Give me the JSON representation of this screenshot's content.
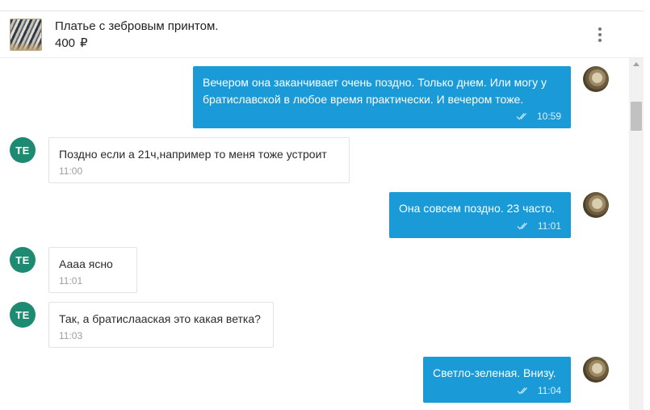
{
  "header": {
    "product_title": "Платье с зебровым принтом.",
    "price": "400",
    "currency": "₽",
    "thumbnail_icon": "dress-thumbnail",
    "menu_icon": "more-vertical-icon"
  },
  "contact": {
    "initials": "TE"
  },
  "messages": [
    {
      "direction": "out",
      "text": "Вечером она заканчивает очень поздно. Только днем. Или могу у братиславской в любое время практически. И вечером тоже.",
      "time": "10:59"
    },
    {
      "direction": "in",
      "text": "Поздно если а 21ч,например то меня тоже устроит",
      "time": "11:00"
    },
    {
      "direction": "out",
      "text": "Она совсем поздно. 23 часто.",
      "time": "11:01"
    },
    {
      "direction": "in",
      "text": "Аааа ясно",
      "time": "11:01"
    },
    {
      "direction": "in",
      "text": "Так, а братислааская это какая ветка?",
      "time": "11:03"
    },
    {
      "direction": "out",
      "text": "Светло-зеленая. Внизу.",
      "time": "11:04"
    }
  ],
  "colors": {
    "outgoing_bubble": "#1a9bd7",
    "contact_avatar": "#1f8a72"
  }
}
